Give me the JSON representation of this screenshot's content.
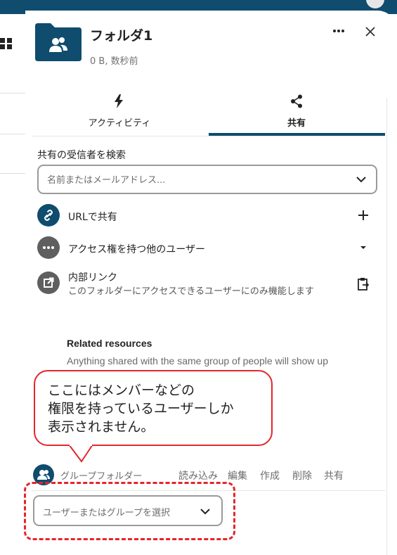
{
  "header": {
    "title": "フォルダ1",
    "subtitle": "0 B, 数秒前",
    "more_icon": "more-horizontal-icon",
    "close_icon": "close-icon"
  },
  "tabs": [
    {
      "label": "アクティビティ",
      "icon": "lightning-icon",
      "active": false
    },
    {
      "label": "共有",
      "icon": "share-icon",
      "active": true
    }
  ],
  "search": {
    "label": "共有の受信者を検索",
    "placeholder": "名前またはメールアドレス..."
  },
  "share_items": {
    "url": {
      "label": "URLで共有",
      "action_icon": "plus-icon"
    },
    "others": {
      "label": "アクセス権を持つ他のユーザー",
      "action_icon": "caret-down-icon"
    },
    "internal": {
      "title": "内部リンク",
      "description": "このフォルダーにアクセスできるユーザーにのみ機能します",
      "action_icon": "clipboard-icon"
    }
  },
  "related": {
    "title": "Related resources",
    "description": "Anything shared with the same group of people will show up"
  },
  "annotation": {
    "text": "ここにはメンバーなどの\n権限を持っているユーザーしか\n表示されません。"
  },
  "group_folder": {
    "label": "グループフォルダー",
    "permissions": [
      "読み込み",
      "編集",
      "作成",
      "削除",
      "共有"
    ]
  },
  "group_select": {
    "placeholder": "ユーザーまたはグループを選択"
  },
  "colors": {
    "accent": "#0f4c6e",
    "highlight": "#e3262c",
    "icon_gray": "#5f5f5f"
  }
}
